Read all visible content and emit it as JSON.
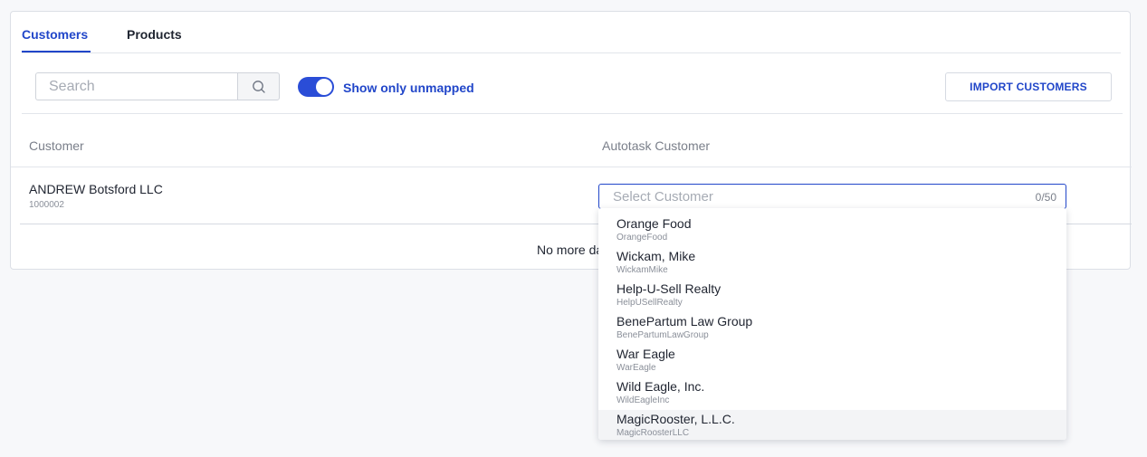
{
  "tabs": [
    {
      "label": "Customers",
      "active": true
    },
    {
      "label": "Products",
      "active": false
    }
  ],
  "toolbar": {
    "search_placeholder": "Search",
    "search_icon": "search-icon",
    "toggle_label": "Show only unmapped",
    "toggle_on": true,
    "import_label": "IMPORT CUSTOMERS"
  },
  "table": {
    "columns": [
      "Customer",
      "Autotask Customer"
    ],
    "rows": [
      {
        "customer_name": "ANDREW Botsford LLC",
        "customer_id": "1000002",
        "select_placeholder": "Select Customer",
        "select_count": "0/50"
      }
    ],
    "footer_text": "No more da"
  },
  "dropdown": {
    "options": [
      {
        "name": "Orange Food",
        "code": "OrangeFood"
      },
      {
        "name": "Wickam, Mike",
        "code": "WickamMike"
      },
      {
        "name": "Help-U-Sell Realty",
        "code": "HelpUSellRealty"
      },
      {
        "name": "BenePartum Law Group",
        "code": "BenePartumLawGroup"
      },
      {
        "name": "War Eagle",
        "code": "WarEagle"
      },
      {
        "name": "Wild Eagle, Inc.",
        "code": "WildEagleInc"
      },
      {
        "name": "MagicRooster, L.L.C.",
        "code": "MagicRoosterLLC"
      }
    ],
    "hovered_index": 6
  },
  "colors": {
    "accent": "#2146c9",
    "toggle": "#2a4dd7",
    "background": "#f7f8fa"
  }
}
